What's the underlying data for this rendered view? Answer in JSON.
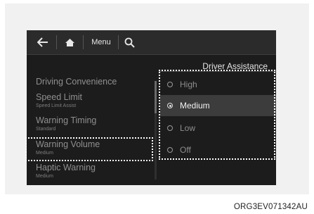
{
  "toolbar": {
    "back_icon": "arrow-left-icon",
    "home_icon": "home-icon",
    "menu_label": "Menu",
    "search_icon": "search-icon"
  },
  "header": {
    "title": "Driver Assistance"
  },
  "left_menu": {
    "items": [
      {
        "label": "Driving Convenience",
        "sub": ""
      },
      {
        "label": "Speed Limit",
        "sub": "Speed Limit Assist"
      },
      {
        "label": "Warning Timing",
        "sub": "Standard"
      },
      {
        "label": "Warning Volume",
        "sub": "Medium"
      },
      {
        "label": "Haptic Warning",
        "sub": "Medium"
      }
    ]
  },
  "options": {
    "items": [
      {
        "label": "High"
      },
      {
        "label": "Medium"
      },
      {
        "label": "Low"
      },
      {
        "label": "Off"
      }
    ],
    "selected": "Medium"
  },
  "caption": "ORG3EV071342AU"
}
